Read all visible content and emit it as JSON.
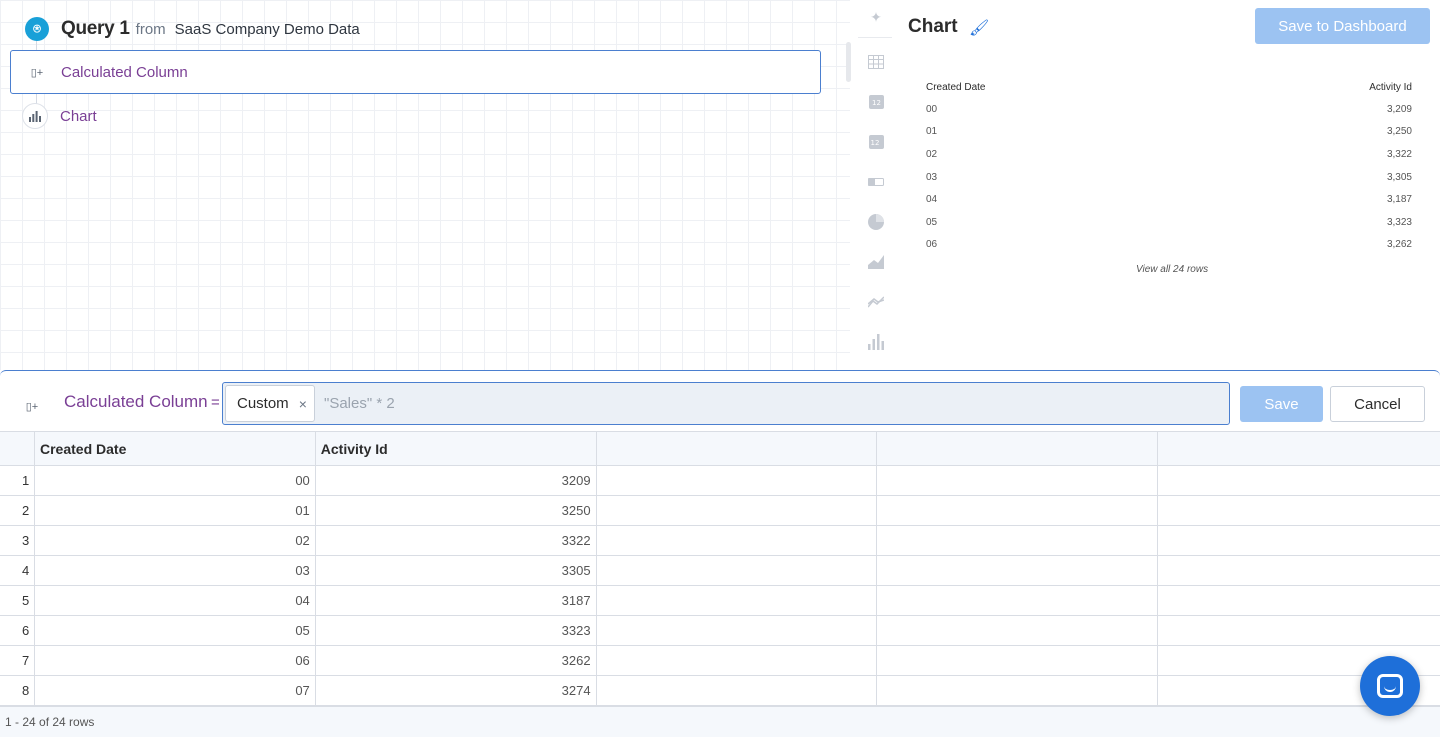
{
  "pipeline": {
    "query_title": "Query 1",
    "from_label": "from",
    "source_name": "SaaS Company Demo Data",
    "steps": [
      {
        "label": "Calculated Column",
        "icon": "calc-column-icon"
      },
      {
        "label": "Chart",
        "icon": "bar-chart-icon"
      }
    ]
  },
  "viz_icons": [
    "magic-wand-icon",
    "table-icon",
    "number-icon",
    "number-change-icon",
    "progress-icon",
    "pie-icon",
    "area-icon",
    "line-icon",
    "bar-icon"
  ],
  "chart_panel": {
    "title": "Chart",
    "save_dashboard_label": "Save to Dashboard",
    "preview": {
      "columns": [
        "Created Date",
        "Activity Id"
      ],
      "rows": [
        [
          "00",
          "3,209"
        ],
        [
          "01",
          "3,250"
        ],
        [
          "02",
          "3,322"
        ],
        [
          "03",
          "3,305"
        ],
        [
          "04",
          "3,187"
        ],
        [
          "05",
          "3,323"
        ],
        [
          "06",
          "3,262"
        ]
      ],
      "view_all": "View all 24 rows"
    }
  },
  "editor": {
    "label": "Calculated Column",
    "equals": "=",
    "chip_label": "Custom",
    "chip_close": "×",
    "formula_placeholder": "\"Sales\" * 2",
    "save_label": "Save",
    "cancel_label": "Cancel"
  },
  "grid": {
    "columns": [
      "Created Date",
      "Activity Id",
      "",
      "",
      ""
    ],
    "rows": [
      {
        "n": "1",
        "date": "00",
        "id": "3209"
      },
      {
        "n": "2",
        "date": "01",
        "id": "3250"
      },
      {
        "n": "3",
        "date": "02",
        "id": "3322"
      },
      {
        "n": "4",
        "date": "03",
        "id": "3305"
      },
      {
        "n": "5",
        "date": "04",
        "id": "3187"
      },
      {
        "n": "6",
        "date": "05",
        "id": "3323"
      },
      {
        "n": "7",
        "date": "06",
        "id": "3262"
      },
      {
        "n": "8",
        "date": "07",
        "id": "3274"
      }
    ],
    "footer": "1 - 24 of 24 rows"
  },
  "colors": {
    "accent": "#1e6fd9",
    "step_purple": "#7a3f95",
    "disabled_blue": "#9cc3f2"
  }
}
